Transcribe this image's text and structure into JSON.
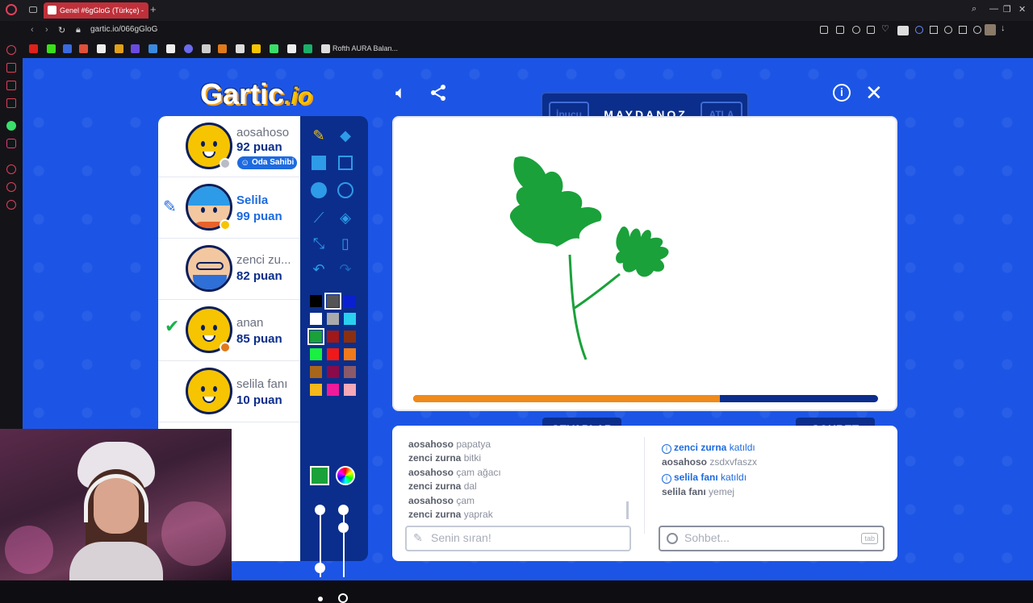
{
  "browser": {
    "tab_title": "Genel #6gGloG (Türkçe) -",
    "url": "gartic.io/066gGloG",
    "bookmark_label": "Rofth AURA Balan...",
    "new_tab": "+"
  },
  "game": {
    "logo_main": "Gartic",
    "logo_suffix": ".io",
    "word": "MAYDANOZ",
    "hint_label": "İpucu",
    "skip_label": "ATLA",
    "timer_progress": 0.66,
    "players": [
      {
        "name": "aosahoso",
        "score": "92 puan",
        "badge": "Oda Sahibi",
        "status_color": "#b8bcc6",
        "avatar": "plain"
      },
      {
        "name": "Selila",
        "score": "99 puan",
        "status_color": "#f6c400",
        "avatar": "blue",
        "drawing": true
      },
      {
        "name": "zenci zu...",
        "score": "82 puan",
        "avatar": "old"
      },
      {
        "name": "anan",
        "score": "85 puan",
        "status_color": "#e07a1a",
        "avatar": "plain",
        "guessed": true
      },
      {
        "name": "selila fanı",
        "score": "10 puan",
        "avatar": "plain"
      }
    ],
    "palette": [
      [
        "#000000",
        "#555555",
        "#0a1fd0"
      ],
      [
        "#ffffff",
        "#aaaaaa",
        "#2ad0f0"
      ],
      [
        "#1aa13a",
        "#a01818",
        "#8a3010"
      ],
      [
        "#1af040",
        "#f01818",
        "#f07a1a"
      ],
      [
        "#a8661a",
        "#8a0a4a",
        "#8a5a6a"
      ],
      [
        "#f6b81a",
        "#f01a9a",
        "#f5a8b8"
      ]
    ],
    "answers_tab": "CEVAPLAR",
    "chat_tab": "SOHBET",
    "answers": [
      {
        "user": "aosahoso",
        "text": "papatya"
      },
      {
        "user": "zenci zurna",
        "text": "bitki"
      },
      {
        "user": "aosahoso",
        "text": "çam ağacı"
      },
      {
        "user": "zenci zurna",
        "text": "dal"
      },
      {
        "user": "aosahoso",
        "text": "çam"
      },
      {
        "user": "zenci zurna",
        "text": "yaprak"
      }
    ],
    "chat": [
      {
        "system": true,
        "user": "zenci zurna",
        "text": "katıldı"
      },
      {
        "user": "aosahoso",
        "text": "zsdxvfaszx"
      },
      {
        "system": true,
        "user": "selila fanı",
        "text": "katıldı"
      },
      {
        "user": "selila fanı",
        "text": "yemej"
      }
    ],
    "answer_placeholder": "Senin sıran!",
    "chat_placeholder": "Sohbet...",
    "tab_key": "tab"
  }
}
